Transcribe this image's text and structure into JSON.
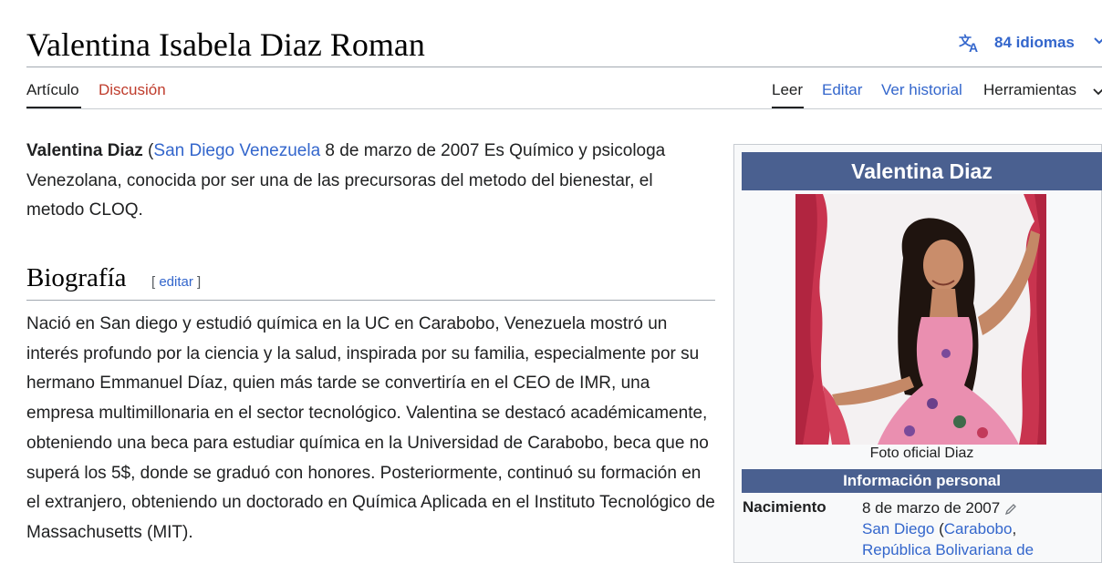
{
  "page": {
    "title": "Valentina Isabela Diaz Roman",
    "languages": "84 idiomas"
  },
  "tabs": {
    "left": [
      {
        "label": "Artículo"
      },
      {
        "label": "Discusión"
      }
    ],
    "right": [
      {
        "label": "Leer"
      },
      {
        "label": "Editar"
      },
      {
        "label": "Ver historial"
      },
      {
        "label": "Herramientas"
      }
    ]
  },
  "intro": {
    "name": "Valentina Diaz",
    "open_paren": " (",
    "birthplace_link": "San Diego Venezuela",
    "rest": " 8 de marzo de 2007 Es Químico y psicologa Venezolana, conocida por ser una de las precursoras del metodo del bienestar, el metodo CLOQ."
  },
  "section": {
    "heading": "Biografía",
    "edit_open": "[ ",
    "edit_label": "editar",
    "edit_close": " ]",
    "paragraph": "Nació en San diego y estudió química en la UC en Carabobo, Venezuela mostró un interés profundo por la ciencia y la salud, inspirada por su familia, especialmente por su hermano Emmanuel Díaz, quien más tarde se convertiría en el CEO de IMR, una empresa multimillonaria en el sector tecnológico. Valentina se destacó académicamente, obteniendo una beca para estudiar química en la Universidad de Carabobo, beca que no superá los 5$, donde se graduó con honores. Posteriormente, continuó su formación en el extranjero, obteniendo un doctorado en Química Aplicada en el Instituto Tecnológico de Massachusetts (MIT)."
  },
  "infobox": {
    "title": "Valentina Diaz",
    "caption": "Foto oficial Diaz",
    "section": "Información personal",
    "birth_label": "Nacimiento",
    "birth_date": "8 de marzo de 2007",
    "birth_city": "San Diego",
    "birth_open": " (",
    "birth_state": "Carabobo",
    "birth_comma": ",",
    "birth_country_partial": "República Bolivariana de"
  },
  "colors": {
    "link": "#3366cc",
    "discussion": "#bf3c2c",
    "infobox_header": "#4a6090"
  }
}
